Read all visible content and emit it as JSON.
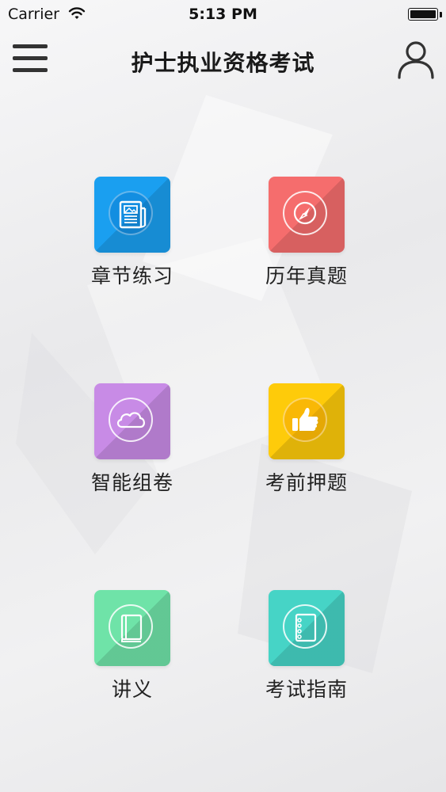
{
  "status_bar": {
    "carrier": "Carrier",
    "time": "5:13 PM"
  },
  "nav": {
    "title": "护士执业资格考试",
    "menu_icon": "hamburger-menu-icon",
    "profile_icon": "user-profile-icon"
  },
  "tiles": [
    {
      "label": "章节练习",
      "icon": "newspaper-icon",
      "color": "#1a9ff0"
    },
    {
      "label": "历年真题",
      "icon": "compass-icon",
      "color": "#f56d6d"
    },
    {
      "label": "智能组卷",
      "icon": "cloud-icon",
      "color": "#c88be6"
    },
    {
      "label": "考前押题",
      "icon": "thumbs-up-icon",
      "color": "#fecb0a"
    },
    {
      "label": "讲义",
      "icon": "book-icon",
      "color": "#6fe3a8"
    },
    {
      "label": "考试指南",
      "icon": "notebook-icon",
      "color": "#46d4c6"
    }
  ]
}
